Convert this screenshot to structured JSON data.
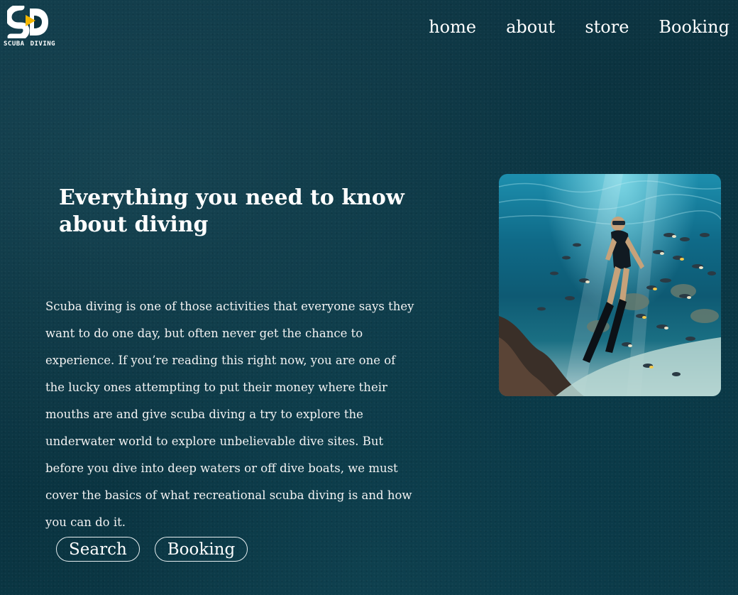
{
  "logo": {
    "mark": "SD",
    "text_left": "SCUBA",
    "text_right": "DIVING",
    "accent_color": "#f5b800"
  },
  "nav": {
    "items": [
      {
        "label": "home"
      },
      {
        "label": "about"
      },
      {
        "label": "store"
      },
      {
        "label": "Booking"
      }
    ]
  },
  "hero": {
    "title": "Everything you need to know about diving",
    "body": "Scuba diving is one of those activities that everyone says they want to do one day, but often never get the chance to experience. If you’re reading this right now, you are one of the lucky ones attempting to put their money where their mouths are and give scuba diving a try to explore the underwater world to explore unbelievable dive sites. But before you dive into deep waters or off dive boats, we must cover the basics of what recreational scuba diving is and how you can do it.",
    "buttons": {
      "search_label": "Search",
      "booking_label": "Booking"
    },
    "image_subject": "freediver-with-fish-photo"
  },
  "colors": {
    "background": "#0b3340",
    "text": "#ffffff"
  }
}
